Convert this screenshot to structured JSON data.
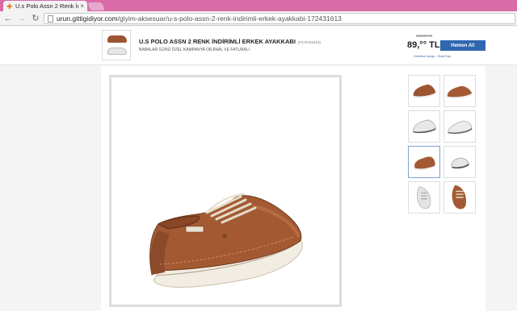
{
  "browser": {
    "tab_title": "U.s Polo Assn 2 Renk İndi",
    "tab_close": "×",
    "url_domain": "urun.gittigidiyor.com",
    "url_path": "/giyim-aksesuar/u-s-polo-assn-2-renk-indirimli-erkek-ayakkabi-172431613"
  },
  "product": {
    "title": "U.S POLO ASSN 2 RENK İNDİRİMLİ ERKEK AYAKKABI",
    "code": "(#172431613)",
    "subtitle": "BABALAR GÜNÜ ÖZEL KAMPANYA ORJİNAL VE FATURALI",
    "old_price": "199,00 TL",
    "price": "89,°° TL",
    "shipping": "Ücretsiz Kargo - Stok Dışı",
    "buy_label": "Hemen Al!"
  },
  "gallery": {
    "thumbnails": [
      {
        "color": "brown",
        "view": "side"
      },
      {
        "color": "brown",
        "view": "side"
      },
      {
        "color": "white",
        "view": "side"
      },
      {
        "color": "white",
        "view": "angle"
      },
      {
        "color": "brown",
        "view": "angle",
        "selected": true
      },
      {
        "color": "white",
        "view": "side"
      },
      {
        "color": "white",
        "view": "back"
      },
      {
        "color": "white",
        "view": "top"
      },
      {
        "color": "brown",
        "view": "top"
      }
    ]
  },
  "colors": {
    "tabstrip": "#d96ba6",
    "leather_brown": "#9c5431",
    "button_blue": "#2f67b1"
  }
}
